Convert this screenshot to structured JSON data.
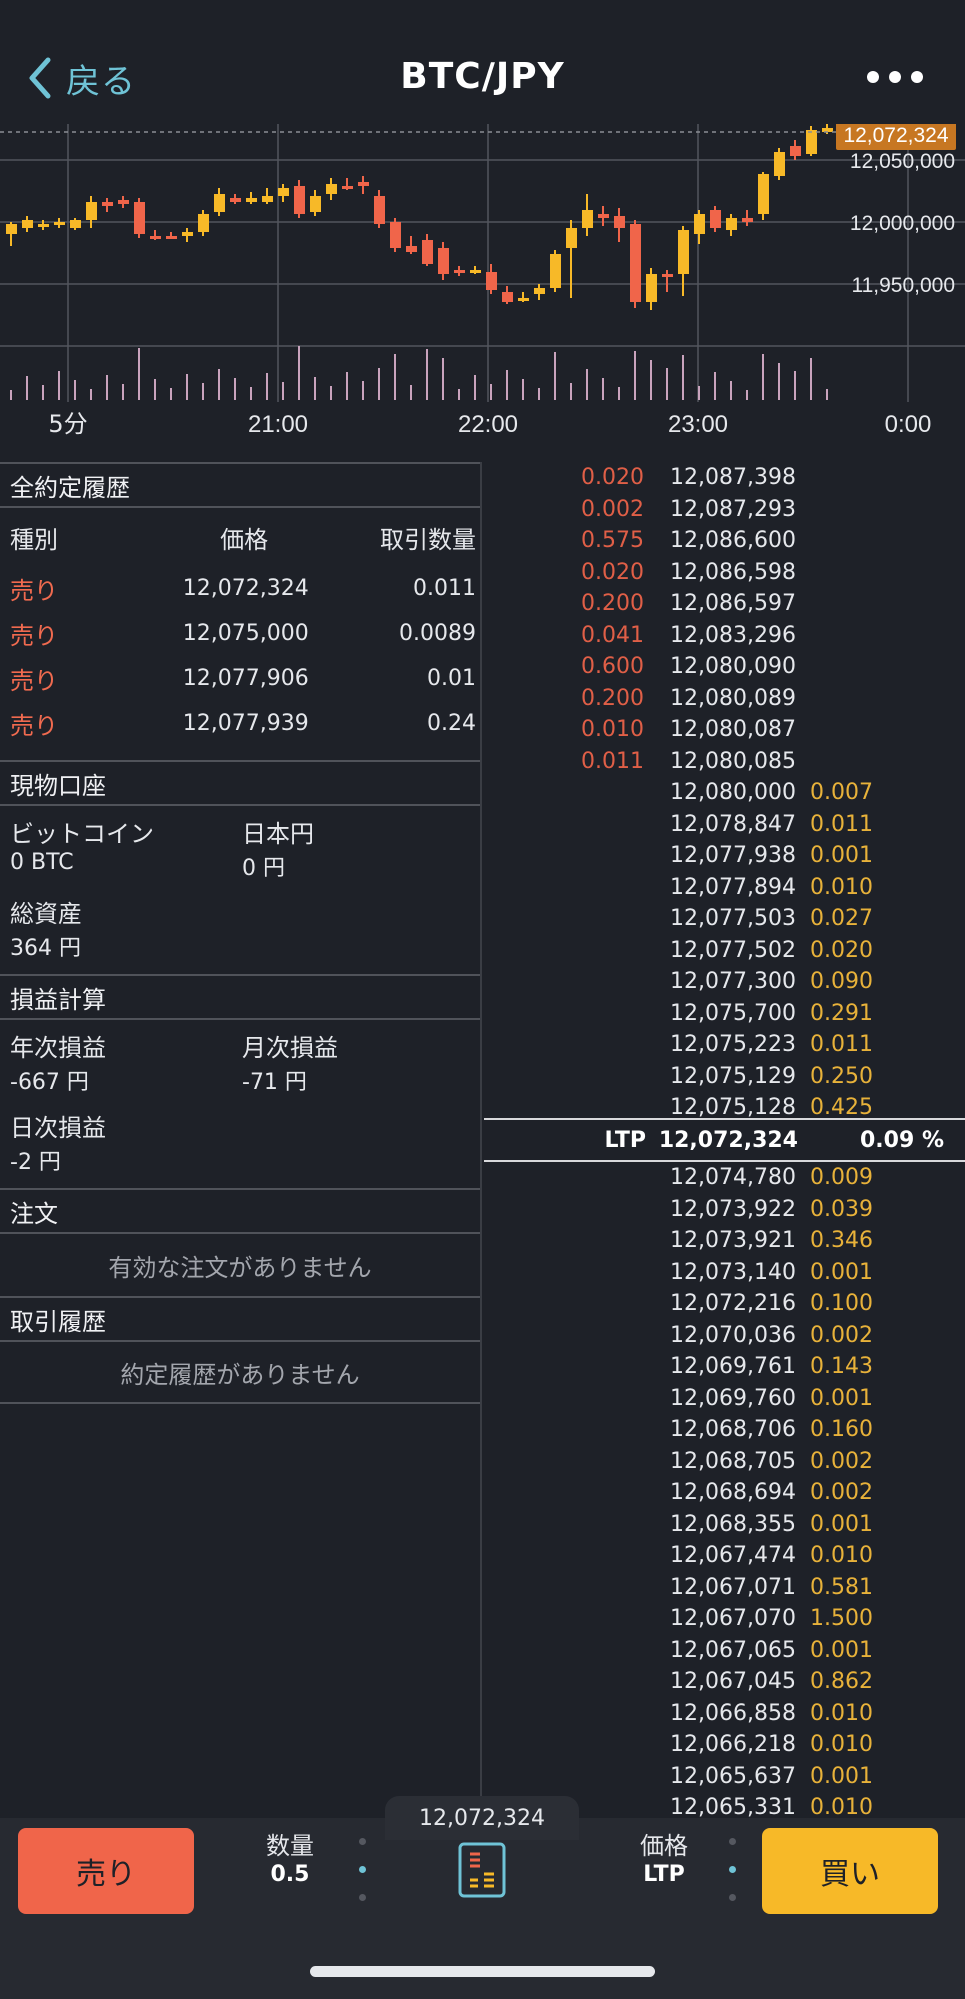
{
  "header": {
    "back_label": "戻る",
    "title": "BTC/JPY"
  },
  "chart": {
    "interval_label": "5分",
    "time_labels": [
      "21:00",
      "22:00",
      "23:00",
      "0:00"
    ],
    "price_labels": [
      "12,050,000",
      "12,000,000",
      "11,950,000"
    ],
    "last_price_tag": "12,072,324",
    "colors": {
      "up": "#f7b928",
      "down": "#f0654a",
      "volume": "#c9a3bd",
      "grid": "#52565e",
      "tag_bg": "#c77722"
    }
  },
  "all_trades": {
    "title": "全約定履歴",
    "headers": {
      "side": "種別",
      "price": "価格",
      "qty": "取引数量"
    },
    "rows": [
      {
        "side": "売り",
        "price": "12,072,324",
        "qty": "0.011"
      },
      {
        "side": "売り",
        "price": "12,075,000",
        "qty": "0.0089"
      },
      {
        "side": "売り",
        "price": "12,077,906",
        "qty": "0.01"
      },
      {
        "side": "売り",
        "price": "12,077,939",
        "qty": "0.24"
      }
    ]
  },
  "spot_account": {
    "title": "現物口座",
    "btc_label": "ビットコイン",
    "btc_value": "0 BTC",
    "jpy_label": "日本円",
    "jpy_value": "0 円",
    "total_label": "総資産",
    "total_value": "364 円"
  },
  "pnl": {
    "title": "損益計算",
    "yearly_label": "年次損益",
    "yearly_value": "-667 円",
    "monthly_label": "月次損益",
    "monthly_value": "-71 円",
    "daily_label": "日次損益",
    "daily_value": "-2 円"
  },
  "orders": {
    "title": "注文",
    "empty": "有効な注文がありません"
  },
  "trade_history": {
    "title": "取引履歴",
    "empty": "約定履歴がありません"
  },
  "order_book": {
    "asks_left": [
      {
        "qty": "0.020",
        "price": "12,087,398"
      },
      {
        "qty": "0.002",
        "price": "12,087,293"
      },
      {
        "qty": "0.575",
        "price": "12,086,600"
      },
      {
        "qty": "0.020",
        "price": "12,086,598"
      },
      {
        "qty": "0.200",
        "price": "12,086,597"
      },
      {
        "qty": "0.041",
        "price": "12,083,296"
      },
      {
        "qty": "0.600",
        "price": "12,080,090"
      },
      {
        "qty": "0.200",
        "price": "12,080,089"
      },
      {
        "qty": "0.010",
        "price": "12,080,087"
      },
      {
        "qty": "0.011",
        "price": "12,080,085"
      }
    ],
    "asks_right": [
      {
        "price": "12,080,000",
        "qty": "0.007"
      },
      {
        "price": "12,078,847",
        "qty": "0.011"
      },
      {
        "price": "12,077,938",
        "qty": "0.001"
      },
      {
        "price": "12,077,894",
        "qty": "0.010"
      },
      {
        "price": "12,077,503",
        "qty": "0.027"
      },
      {
        "price": "12,077,502",
        "qty": "0.020"
      },
      {
        "price": "12,077,300",
        "qty": "0.090"
      },
      {
        "price": "12,075,700",
        "qty": "0.291"
      },
      {
        "price": "12,075,223",
        "qty": "0.011"
      },
      {
        "price": "12,075,129",
        "qty": "0.250"
      },
      {
        "price": "12,075,128",
        "qty": "0.425"
      }
    ],
    "ltp": {
      "label": "LTP",
      "price": "12,072,324",
      "change": "0.09 %"
    },
    "bids": [
      {
        "price": "12,074,780",
        "qty": "0.009"
      },
      {
        "price": "12,073,922",
        "qty": "0.039"
      },
      {
        "price": "12,073,921",
        "qty": "0.346"
      },
      {
        "price": "12,073,140",
        "qty": "0.001"
      },
      {
        "price": "12,072,216",
        "qty": "0.100"
      },
      {
        "price": "12,070,036",
        "qty": "0.002"
      },
      {
        "price": "12,069,761",
        "qty": "0.143"
      },
      {
        "price": "12,069,760",
        "qty": "0.001"
      },
      {
        "price": "12,068,706",
        "qty": "0.160"
      },
      {
        "price": "12,068,705",
        "qty": "0.002"
      },
      {
        "price": "12,068,694",
        "qty": "0.002"
      },
      {
        "price": "12,068,355",
        "qty": "0.001"
      },
      {
        "price": "12,067,474",
        "qty": "0.010"
      },
      {
        "price": "12,067,071",
        "qty": "0.581"
      },
      {
        "price": "12,067,070",
        "qty": "1.500"
      },
      {
        "price": "12,067,065",
        "qty": "0.001"
      },
      {
        "price": "12,067,045",
        "qty": "0.862"
      },
      {
        "price": "12,066,858",
        "qty": "0.010"
      },
      {
        "price": "12,066,218",
        "qty": "0.010"
      },
      {
        "price": "12,065,637",
        "qty": "0.001"
      },
      {
        "price": "12,065,331",
        "qty": "0.010"
      }
    ]
  },
  "bottom_bar": {
    "sell_label": "売り",
    "buy_label": "買い",
    "qty_label": "数量",
    "qty_value": "0.5",
    "price_label": "価格",
    "price_value": "LTP",
    "ltp_tab": "12,072,324"
  }
}
